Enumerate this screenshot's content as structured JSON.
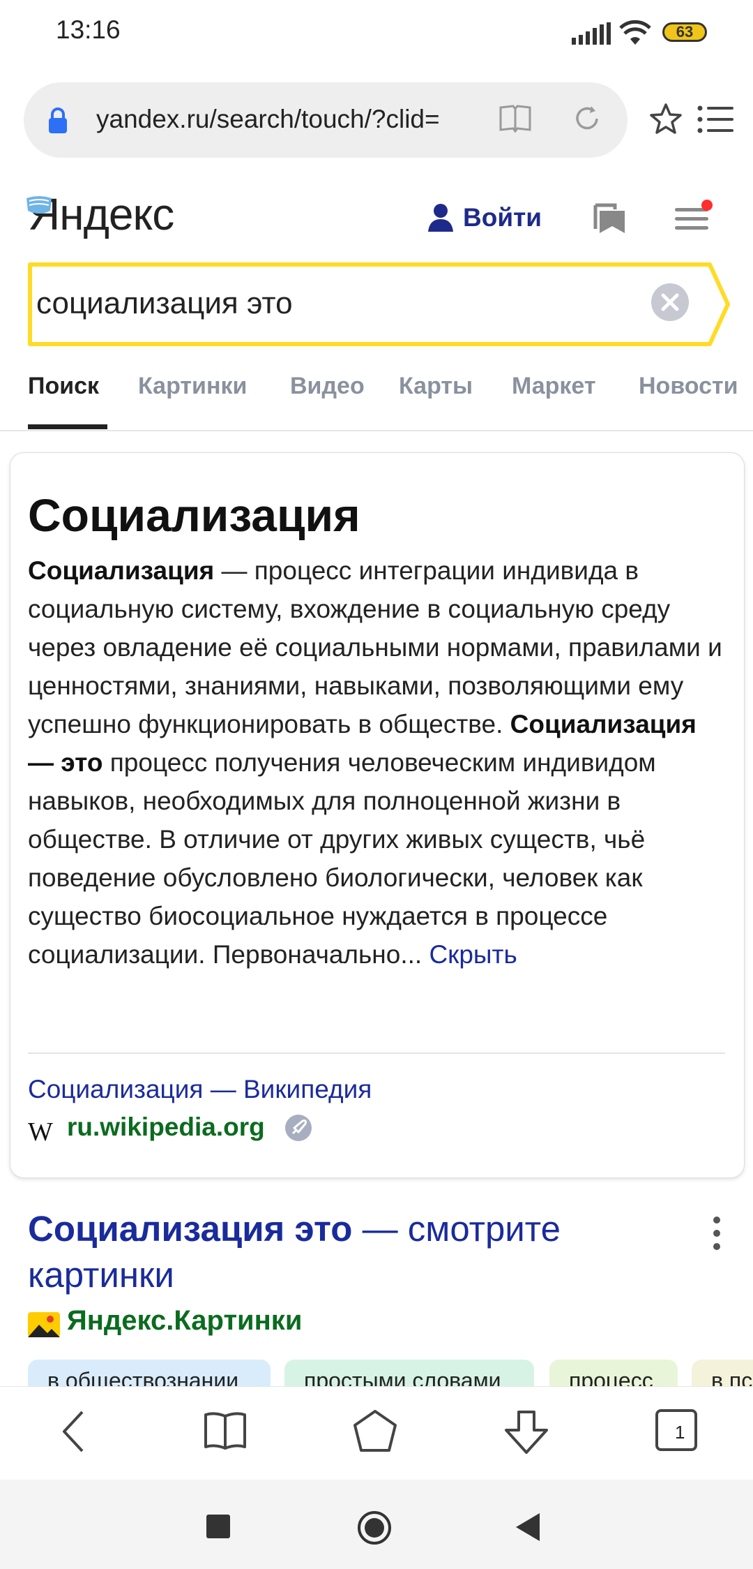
{
  "status_bar": {
    "time": "13:16",
    "battery": "63"
  },
  "address_bar": {
    "url": "yandex.ru/search/touch/?clid="
  },
  "header": {
    "logo": "Яндекс",
    "login_label": "Войти"
  },
  "search": {
    "query": "социализация это"
  },
  "tabs": [
    {
      "label": "Поиск",
      "active": true
    },
    {
      "label": "Картинки"
    },
    {
      "label": "Видео"
    },
    {
      "label": "Карты"
    },
    {
      "label": "Маркет"
    },
    {
      "label": "Новости"
    }
  ],
  "wiki_card": {
    "title": "Социализация",
    "text_parts": [
      "Социализация",
      " — процесс интеграции индивида в социальную систему, вхождение в социальную среду через овладение её социальными нормами, правилами и ценностями, знаниями, навыками, позволяющими ему успешно функционировать в обществе. ",
      "Социализация — это",
      " процесс получения человеческим индивидом навыков, необходимых для полноценной жизни в обществе. В отличие от других живых существ, чьё поведение обусловлено биологически, человек как существо биосоциальное нуждается в процессе социализации. Первоначально... "
    ],
    "hide_link": "Скрыть",
    "source_title": "Социализация — Википедия",
    "source_domain": "ru.wikipedia.org"
  },
  "result2": {
    "title_bold": "Социализация это",
    "title_rest": " — смотрите картинки",
    "source": "Яндекс.Картинки",
    "chips": [
      "в обществознании",
      "простыми словами",
      "процесс",
      "в пс"
    ]
  },
  "toolbar": {
    "tab_count": "1"
  },
  "colors": {
    "yandex_red": "#ff3333",
    "link_blue": "#1a2b9c",
    "source_green": "#0b6b1f",
    "search_border": "#ffdb26"
  }
}
